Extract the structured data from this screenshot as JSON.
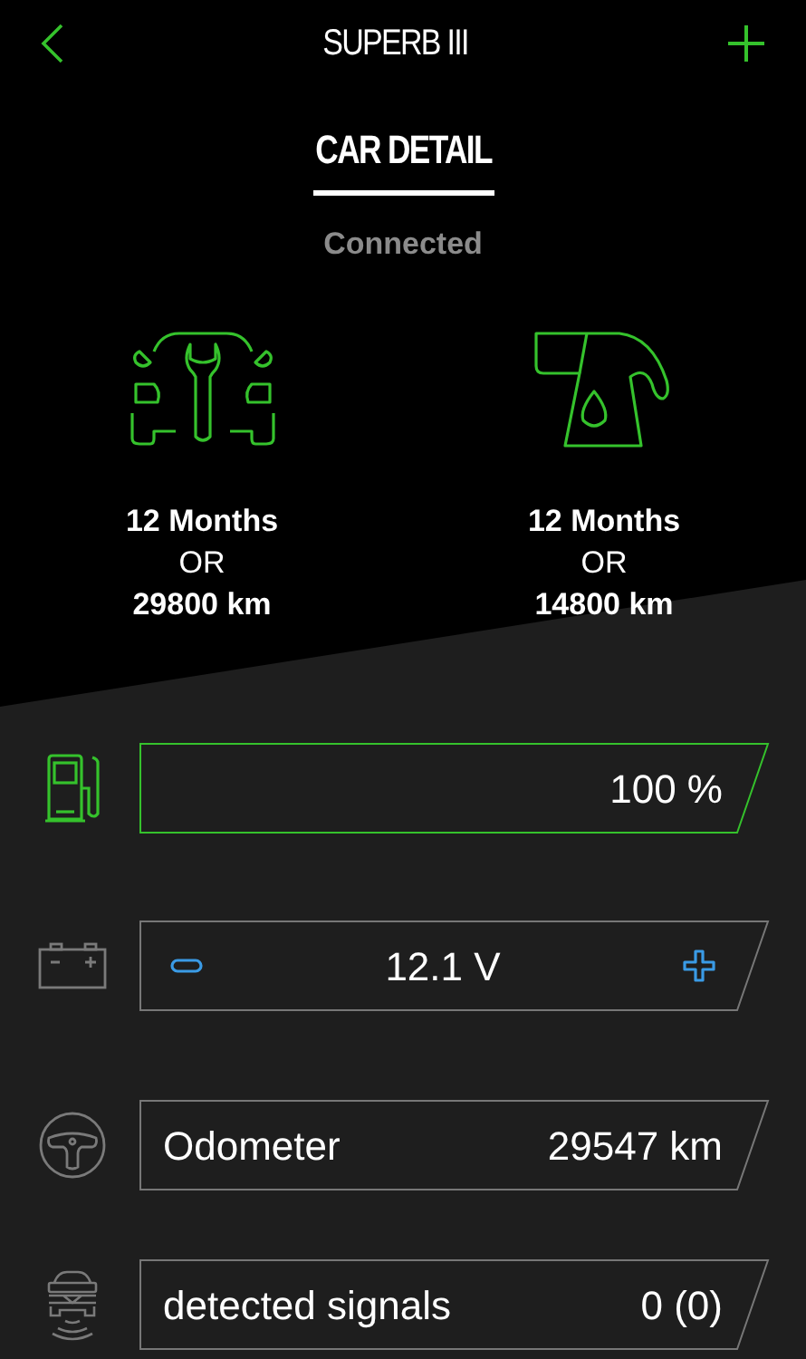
{
  "header": {
    "title": "SUPERB III"
  },
  "tabs": [
    {
      "label": "CAR DETAIL",
      "selected": true
    }
  ],
  "status": "Connected",
  "service_intervals": [
    {
      "kind": "inspection",
      "time": "12 Months",
      "separator": "OR",
      "distance": "29800 km"
    },
    {
      "kind": "oil",
      "time": "12 Months",
      "separator": "OR",
      "distance": "14800 km"
    }
  ],
  "gauges": [
    {
      "kind": "fuel",
      "highlighted": true,
      "value": "100 %"
    },
    {
      "kind": "battery",
      "highlighted": false,
      "value": "12.1 V"
    },
    {
      "kind": "odometer",
      "highlighted": false,
      "label": "Odometer",
      "value": "29547 km"
    },
    {
      "kind": "signals",
      "highlighted": false,
      "label": "detected signals",
      "value": "0 (0)"
    }
  ]
}
